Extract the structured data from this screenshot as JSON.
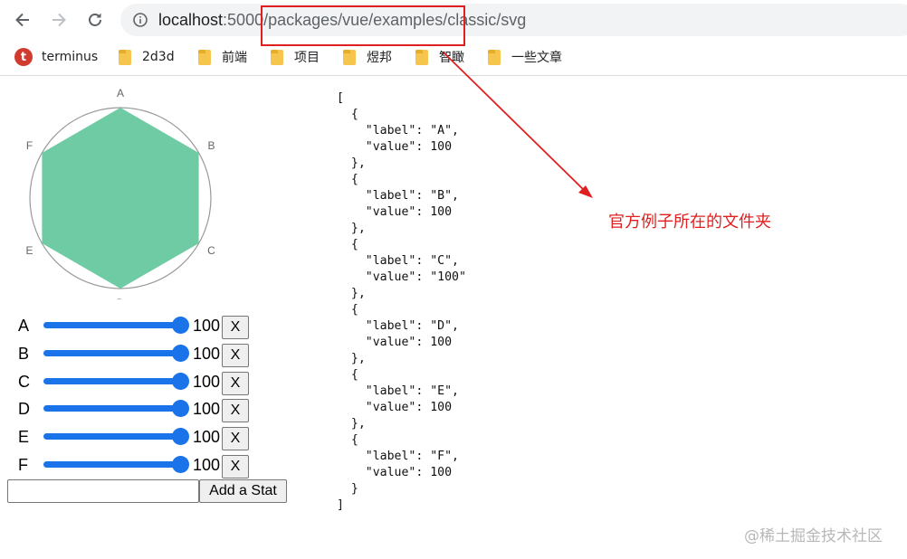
{
  "browser": {
    "url_host": "localhost",
    "url_rest": ":5000/packages/vue/examples/classic/svg",
    "bookmarks": [
      {
        "label": "terminus",
        "icon": "terminus-logo-icon",
        "logo_letter": "t"
      },
      {
        "label": "2d3d",
        "icon": "folder-icon"
      },
      {
        "label": "前端",
        "icon": "folder-icon"
      },
      {
        "label": "项目",
        "icon": "folder-icon"
      },
      {
        "label": "煜邦",
        "icon": "folder-icon"
      },
      {
        "label": "智瞰",
        "icon": "folder-icon"
      },
      {
        "label": "一些文章",
        "icon": "folder-icon"
      }
    ]
  },
  "radar": {
    "axis_labels": [
      "A",
      "B",
      "C",
      "D",
      "E",
      "F"
    ],
    "fill_color": "#6fcba3",
    "circle_color": "#999999"
  },
  "stats": [
    {
      "label": "A",
      "value": "100",
      "remove_label": "X"
    },
    {
      "label": "B",
      "value": "100",
      "remove_label": "X"
    },
    {
      "label": "C",
      "value": "100",
      "remove_label": "X"
    },
    {
      "label": "D",
      "value": "100",
      "remove_label": "X"
    },
    {
      "label": "E",
      "value": "100",
      "remove_label": "X"
    },
    {
      "label": "F",
      "value": "100",
      "remove_label": "X"
    }
  ],
  "new_stat": {
    "input_value": "",
    "add_label": "Add a Stat"
  },
  "json_dump": "[\n  {\n    \"label\": \"A\",\n    \"value\": 100\n  },\n  {\n    \"label\": \"B\",\n    \"value\": 100\n  },\n  {\n    \"label\": \"C\",\n    \"value\": \"100\"\n  },\n  {\n    \"label\": \"D\",\n    \"value\": 100\n  },\n  {\n    \"label\": \"E\",\n    \"value\": 100\n  },\n  {\n    \"label\": \"F\",\n    \"value\": 100\n  }\n]",
  "annotation": {
    "text": "官方例子所在的文件夹",
    "color": "#e02020"
  },
  "watermark": "@稀土掘金技术社区"
}
